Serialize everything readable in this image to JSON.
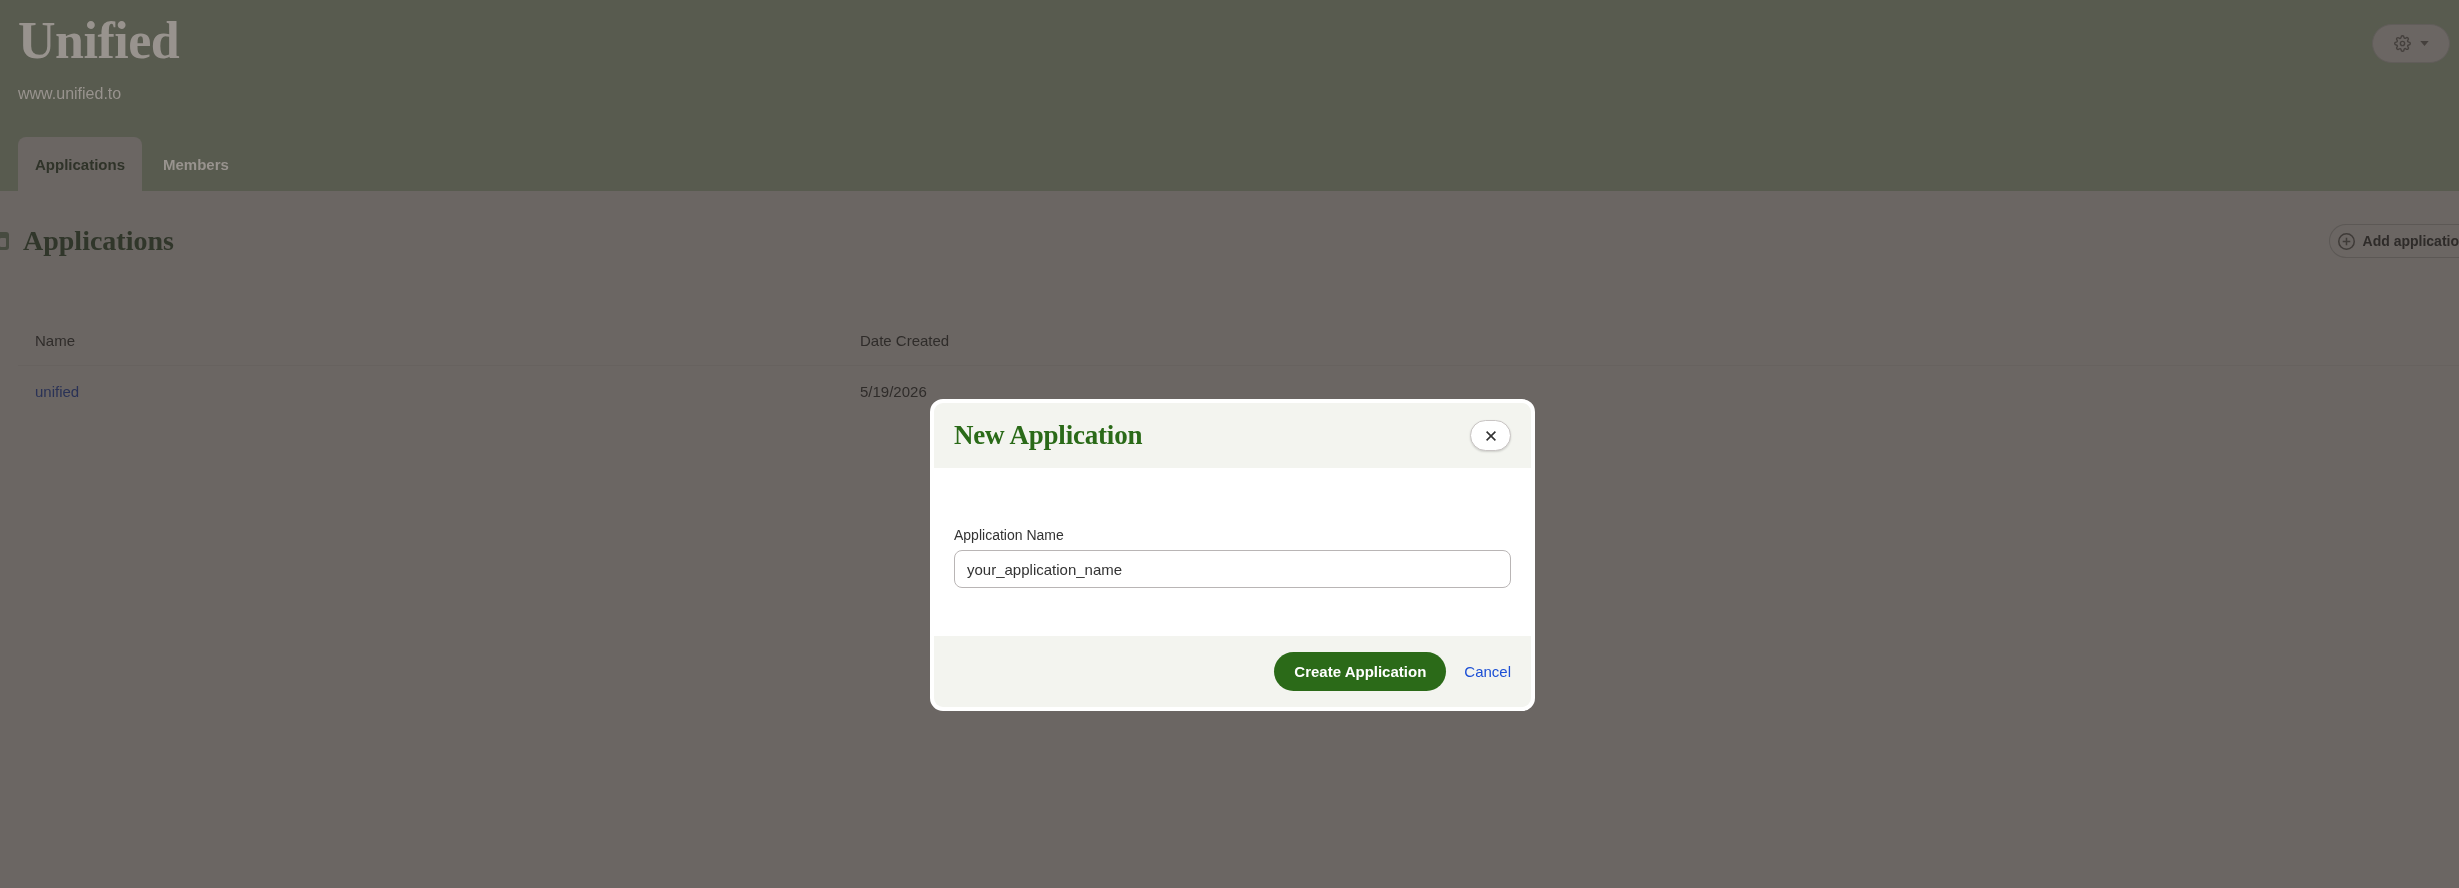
{
  "header": {
    "title": "Unified",
    "subtitle": "www.unified.to"
  },
  "tabs": [
    {
      "label": "Applications",
      "selected": true
    },
    {
      "label": "Members",
      "selected": false
    }
  ],
  "section": {
    "heading": "Applications",
    "add_button": "Add applicatio"
  },
  "table": {
    "columns": [
      "Name",
      "Date Created"
    ],
    "rows": [
      {
        "name": "unified",
        "date_created": "5/19/2026"
      }
    ]
  },
  "dialog": {
    "title": "New Application",
    "field": {
      "label": "Application Name",
      "value": "your_application_name"
    },
    "buttons": [
      {
        "label": "Create Application",
        "kind": "primary"
      },
      {
        "label": "Cancel",
        "kind": "link"
      }
    ]
  }
}
